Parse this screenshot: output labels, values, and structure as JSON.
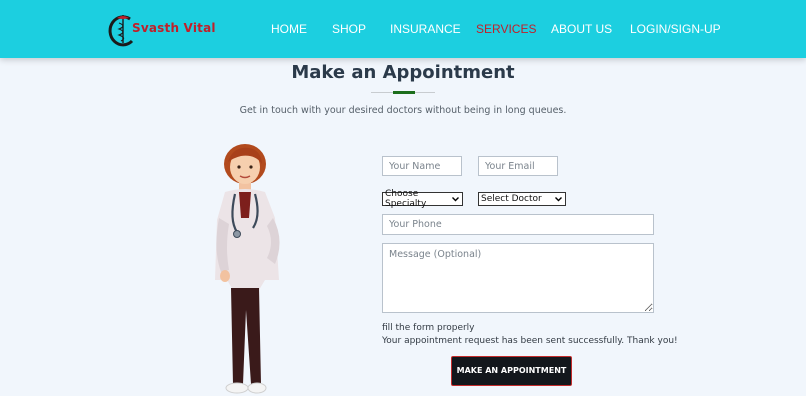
{
  "brand": {
    "name": "Svasth Vital",
    "logo_icon": "caduceus-icon"
  },
  "nav": {
    "items": [
      "HOME",
      "SHOP",
      "INSURANCE",
      "SERVICES",
      "ABOUT US",
      "LOGIN/SIGN-UP"
    ],
    "active": "SERVICES"
  },
  "header": {
    "title": "Make an Appointment",
    "subtitle": "Get in touch with your desired doctors without being in long queues."
  },
  "form": {
    "name_placeholder": "Your Name",
    "email_placeholder": "Your Email",
    "specialty_selected": "Choose Specialty",
    "doctor_selected": "Select Doctor",
    "phone_placeholder": "Your Phone",
    "message_placeholder": "Message (Optional)",
    "validation_message": "fill the form properly",
    "success_message": "Your appointment request has been sent successfully. Thank you!",
    "submit_label": "MAKE AN APPOINTMENT"
  },
  "colors": {
    "navbar": "#1ccfe0",
    "active_nav": "#c0202a",
    "background": "#f1f6fc",
    "button": "#13171c",
    "accent_line": "#1c6e1c"
  }
}
